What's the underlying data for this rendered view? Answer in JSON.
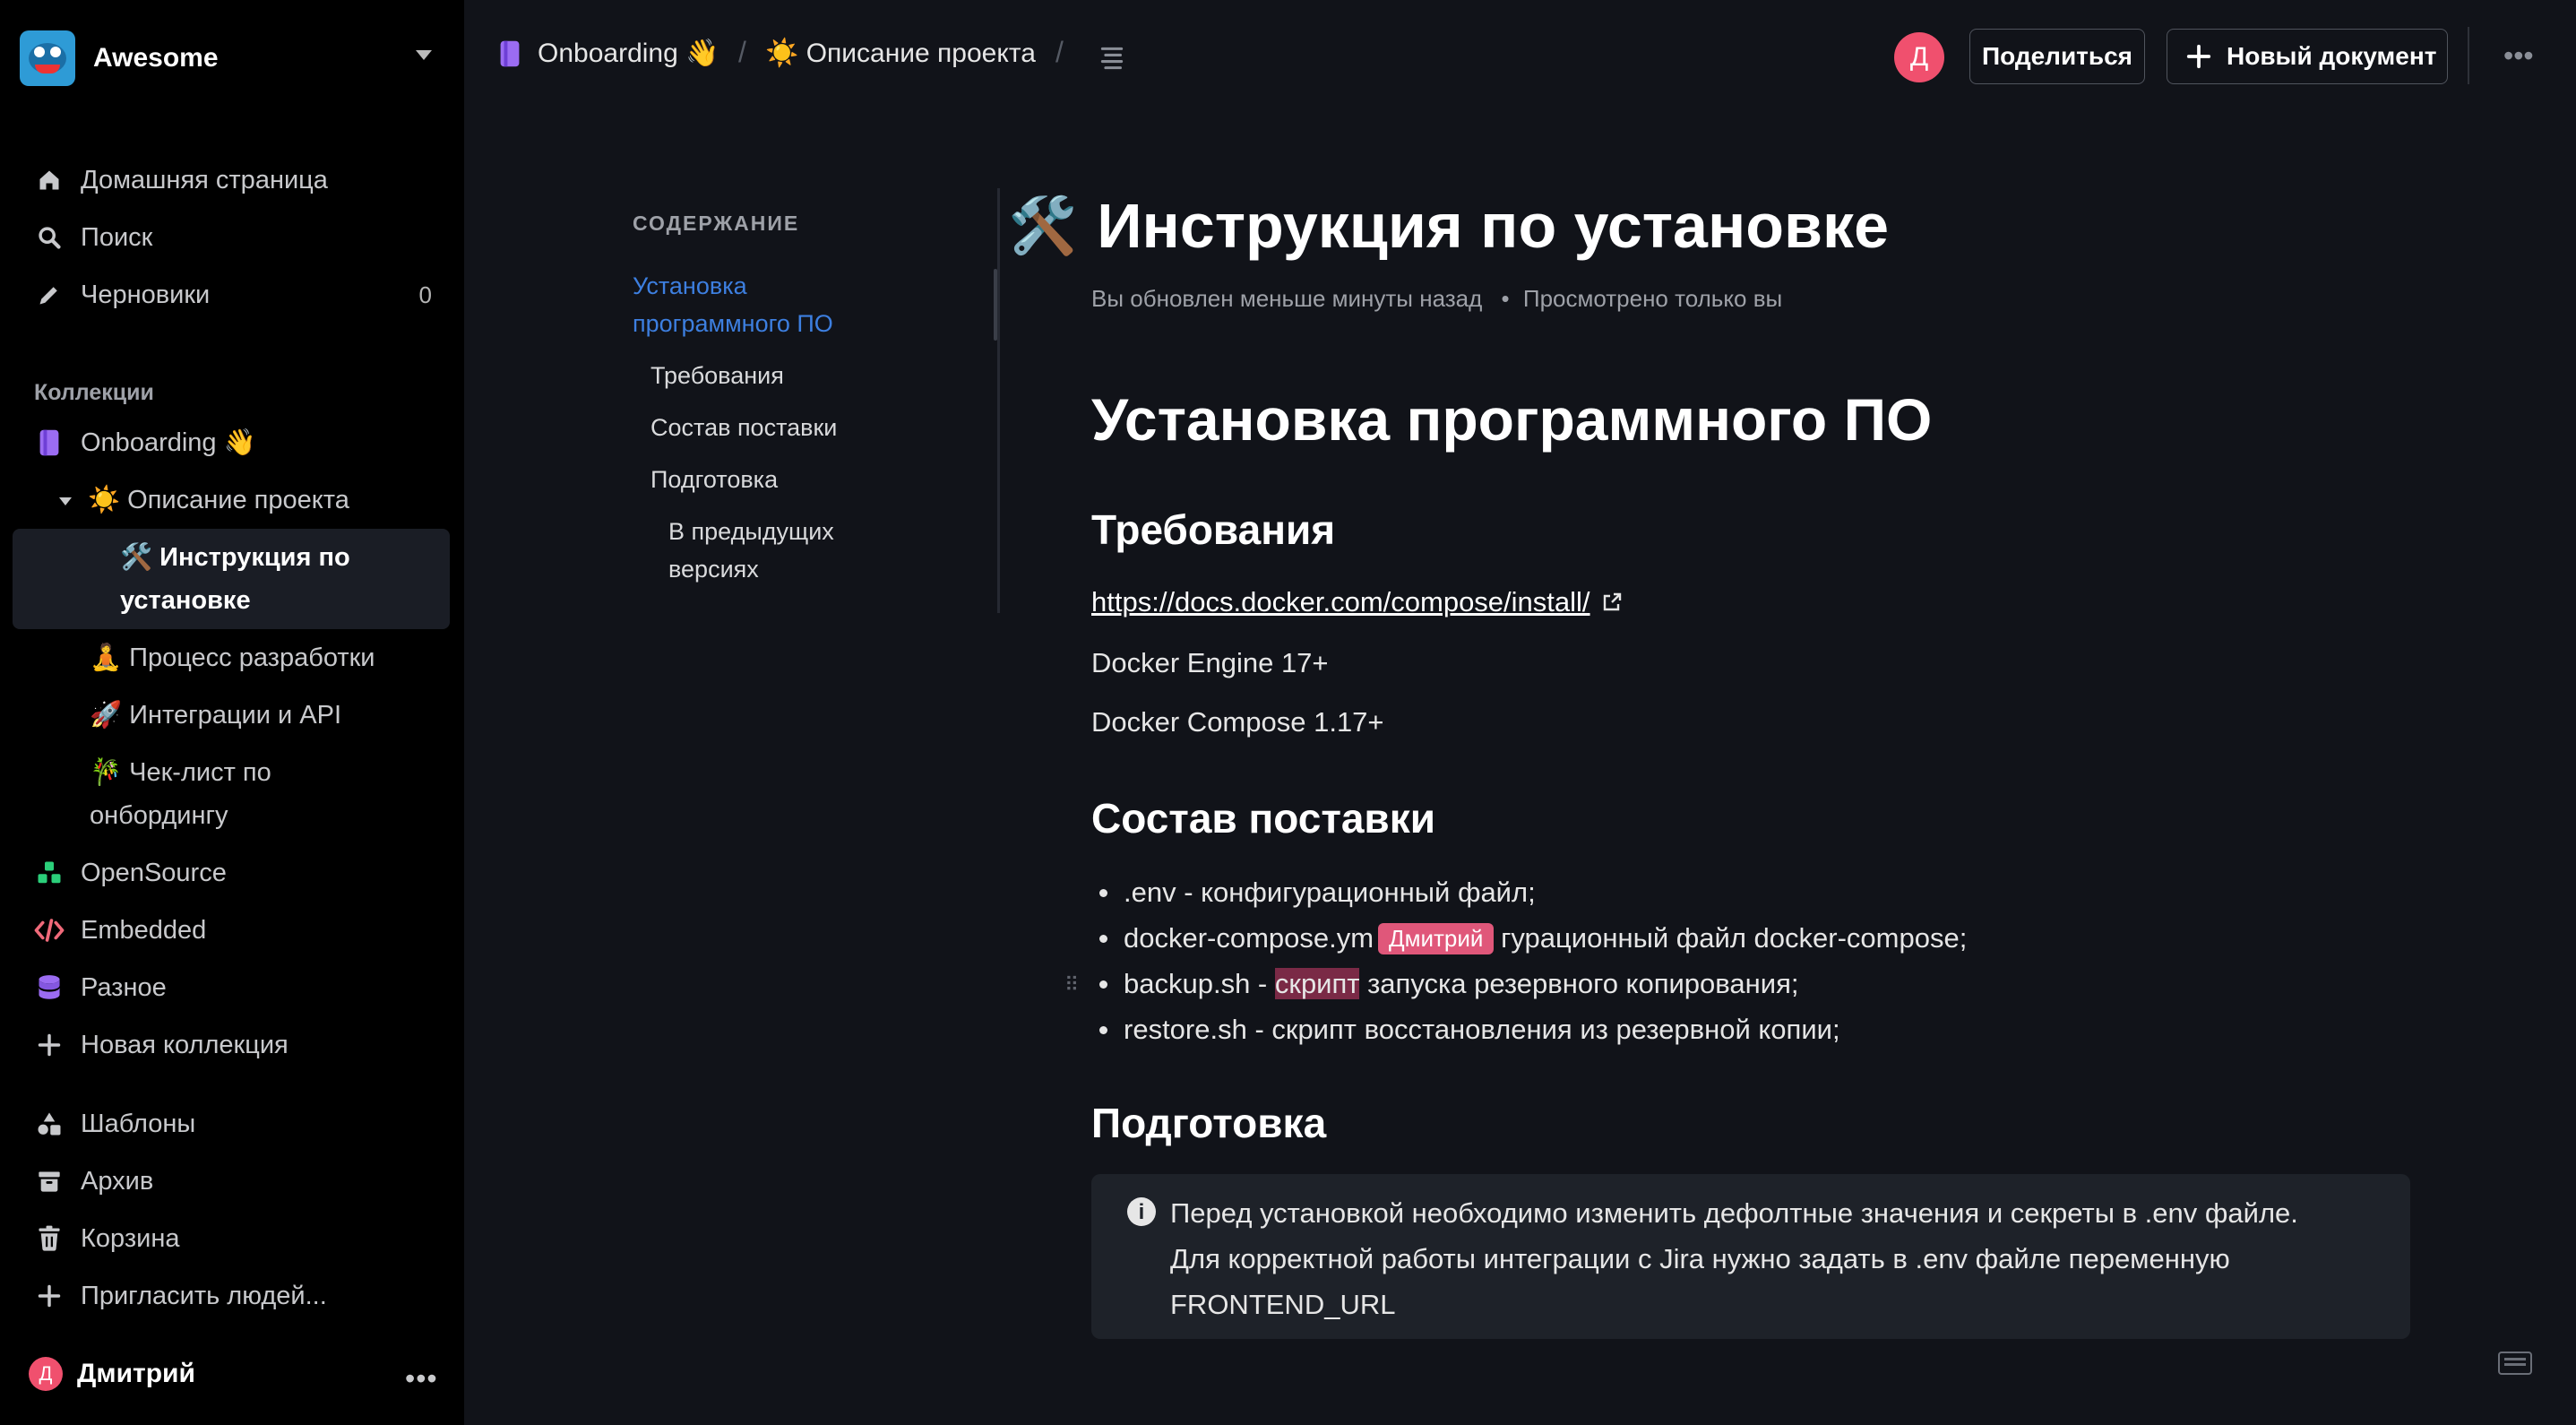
{
  "sidebar": {
    "team_name": "Awesome",
    "nav": [
      {
        "label": "Домашняя страница",
        "icon": "home-icon"
      },
      {
        "label": "Поиск",
        "icon": "search-icon"
      },
      {
        "label": "Черновики",
        "icon": "pencil-icon",
        "count": "0"
      }
    ],
    "collections_label": "Коллекции",
    "collections": [
      {
        "label": "Onboarding 👋",
        "icon": "book-icon"
      },
      {
        "label": "OpenSource",
        "icon": "shapes-icon"
      },
      {
        "label": "Embedded",
        "icon": "code-icon"
      },
      {
        "label": "Разное",
        "icon": "database-icon"
      },
      {
        "label": "Новая коллекция",
        "icon": "plus-icon"
      }
    ],
    "docs": {
      "parent": "☀️ Описание проекта",
      "active_line1": "🛠️ Инструкция по",
      "active_line2": "установке",
      "dev": "🧘 Процесс разработки",
      "api": "🚀 Интеграции и API",
      "checklist_line1": "🎋 Чек-лист по",
      "checklist_line2": "онбордингу"
    },
    "footer_nav": [
      {
        "label": "Шаблоны",
        "icon": "templates-icon"
      },
      {
        "label": "Архив",
        "icon": "archive-icon"
      },
      {
        "label": "Корзина",
        "icon": "trash-icon"
      },
      {
        "label": "Пригласить людей...",
        "icon": "plus-icon"
      }
    ],
    "user": {
      "name": "Дмитрий",
      "initial": "Д"
    }
  },
  "header": {
    "breadcrumb_collection": "Onboarding 👋",
    "breadcrumb_doc": "☀️ Описание проекта",
    "avatar_initial": "Д",
    "share_label": "Поделиться",
    "new_doc_label": "Новый документ"
  },
  "toc": {
    "heading": "СОДЕРЖАНИЕ",
    "items": [
      {
        "label_line1": "Установка",
        "label_line2": "программного ПО"
      },
      {
        "label": "Требования"
      },
      {
        "label": "Состав поставки"
      },
      {
        "label": "Подготовка"
      },
      {
        "label_line1": "В предыдущих",
        "label_line2": "версиях"
      }
    ]
  },
  "document": {
    "title_emoji": "🛠️",
    "title": "Инструкция по установке",
    "meta_updated": "Вы обновлен меньше минуты назад",
    "meta_viewed": "Просмотрено только вы",
    "h1": "Установка программного ПО",
    "requirements_heading": "Требования",
    "link": "https://docs.docker.com/compose/install/",
    "req_1": "Docker Engine 17+",
    "req_2": "Docker Compose 1.17+",
    "contents_heading": "Состав поставки",
    "list": {
      "item1": ".env - конфигурационный файл;",
      "item2_a": "docker-compose.ym",
      "item2_b": "гурационный файл docker-compose;",
      "item3_a": "backup.sh - ",
      "item3_hl": "скрипт",
      "item3_b": " запуска резервного копирования;",
      "item4": "restore.sh - скрипт восстановления из резервной копии;"
    },
    "cursor_user": "Дмитрий",
    "prep_heading": "Подготовка",
    "notice_line1": "Перед установкой необходимо изменить дефолтные значения и секреты в .env файле.",
    "notice_line2": "Для корректной работы интеграции с Jira нужно задать в .env файле переменную",
    "notice_line3": "FRONTEND_URL"
  }
}
